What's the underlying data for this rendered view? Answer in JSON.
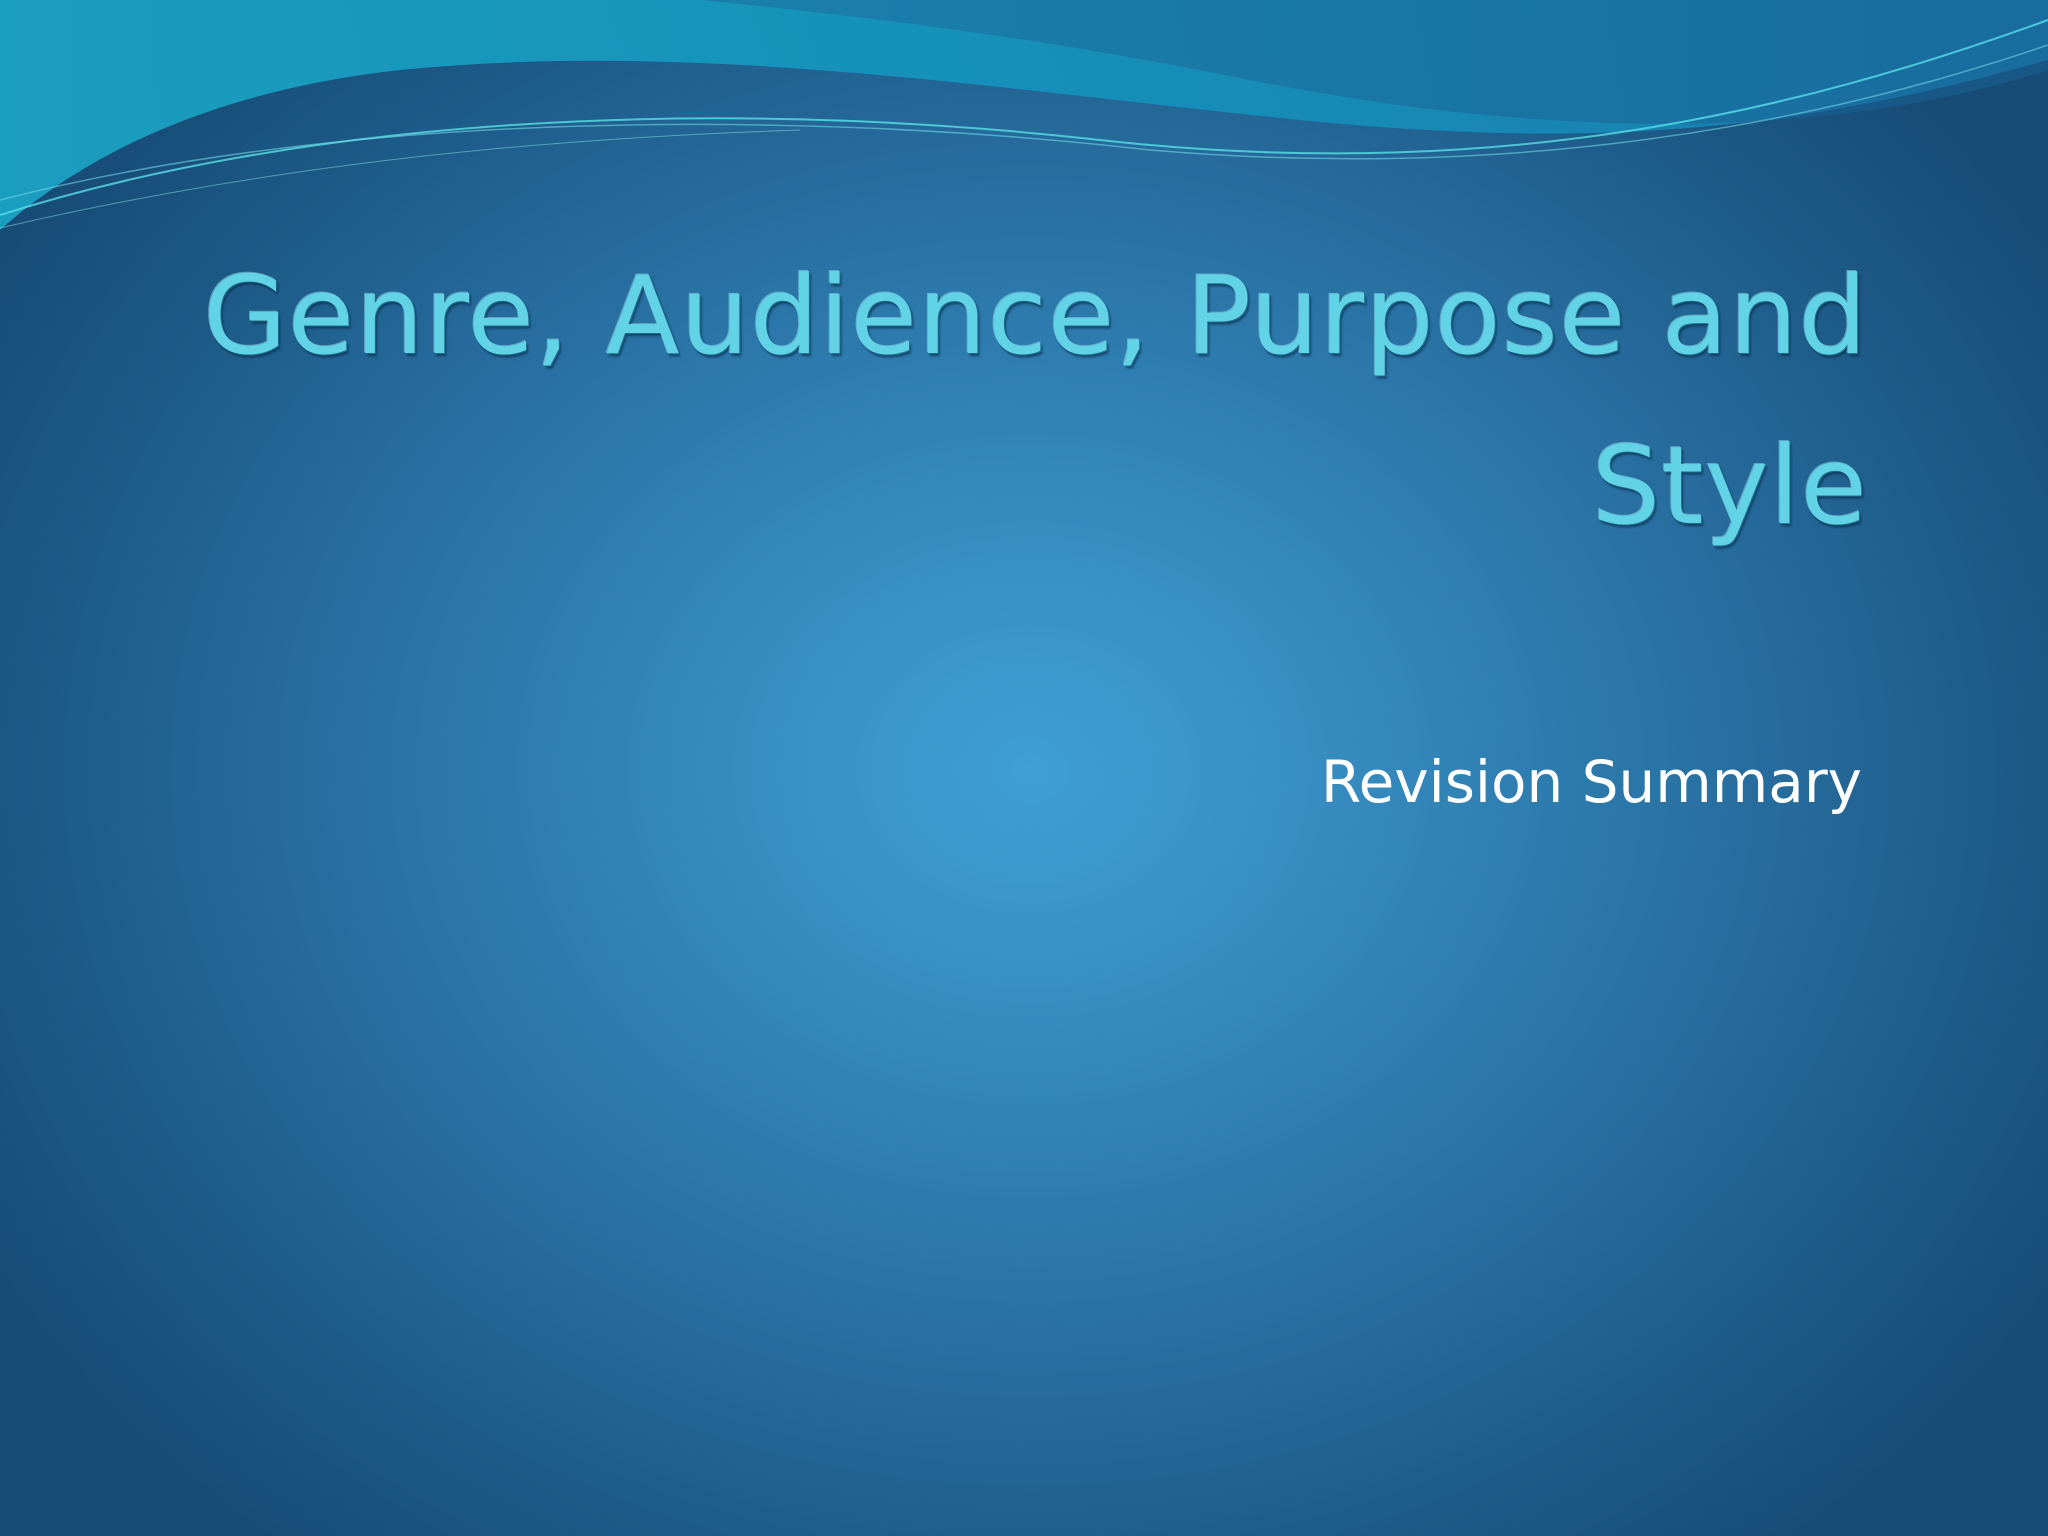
{
  "slide": {
    "title": "Genre, Audience, Purpose and Style",
    "subtitle": "Revision Summary"
  },
  "colors": {
    "background_center": "#3f9fd6",
    "background_edge": "#174c76",
    "title_text": "#62d3e6",
    "subtitle_text": "#ffffff",
    "wave_band": "#1690b8"
  }
}
